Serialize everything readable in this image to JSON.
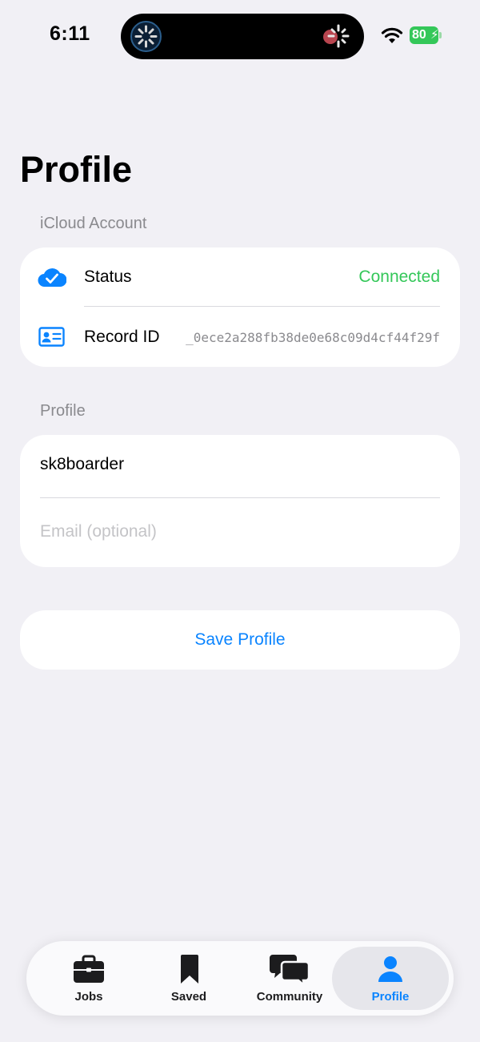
{
  "status_bar": {
    "time": "6:11",
    "battery": "80"
  },
  "page": {
    "title": "Profile"
  },
  "icloud_section": {
    "header": "iCloud Account",
    "status_label": "Status",
    "status_value": "Connected",
    "status_color": "#34c759",
    "record_label": "Record ID",
    "record_value": "_0ece2a288fb38de0e68c09d4cf44f29f"
  },
  "profile_section": {
    "header": "Profile",
    "username_value": "sk8boarder",
    "email_placeholder": "Email (optional)"
  },
  "save_button": {
    "label": "Save Profile"
  },
  "tab_bar": {
    "tabs": [
      {
        "label": "Jobs",
        "icon": "briefcase-icon"
      },
      {
        "label": "Saved",
        "icon": "bookmark-icon"
      },
      {
        "label": "Community",
        "icon": "chat-bubbles-icon"
      },
      {
        "label": "Profile",
        "icon": "person-icon"
      }
    ],
    "selected": "Profile",
    "accent_color": "#0a84ff"
  }
}
